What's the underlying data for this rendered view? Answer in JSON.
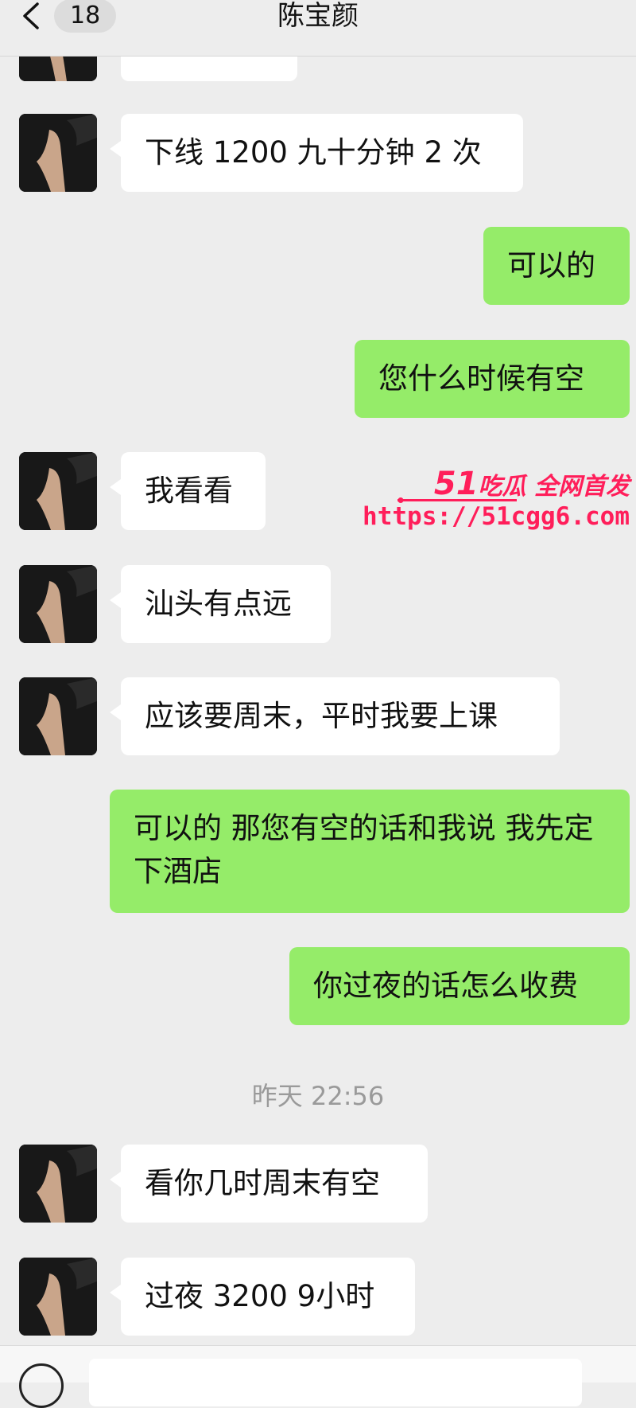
{
  "header": {
    "title": "陈宝颜",
    "unread_count": "18",
    "back_icon": "chevron-left-icon"
  },
  "messages": [
    {
      "side": "in",
      "text": "下线 1200 九十分钟 2 次"
    },
    {
      "side": "out",
      "text": "可以的"
    },
    {
      "side": "out",
      "text": "您什么时候有空"
    },
    {
      "side": "in",
      "text": "我看看"
    },
    {
      "side": "in",
      "text": "汕头有点远"
    },
    {
      "side": "in",
      "text": "应该要周末，平时我要上课"
    },
    {
      "side": "out",
      "text": "可以的 那您有空的话和我说 我先定下酒店"
    },
    {
      "side": "out",
      "text": "你过夜的话怎么收费"
    },
    {
      "side": "in",
      "text": "看你几时周末有空"
    },
    {
      "side": "in",
      "text": "过夜 3200 9小时"
    }
  ],
  "time_divider": "昨天 22:56",
  "watermark": {
    "logo_number": "51",
    "logo_text": "吃瓜 全网首发",
    "url": "https://51cgg6.com"
  },
  "colors": {
    "outgoing_bubble": "#95ec69",
    "incoming_bubble": "#ffffff",
    "background": "#ededed",
    "watermark": "#ff1e5a"
  }
}
